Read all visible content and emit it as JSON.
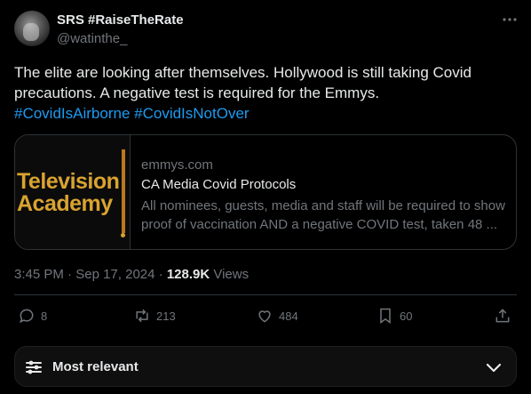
{
  "author": {
    "name": "SRS #RaiseTheRate",
    "handle": "@watinthe_"
  },
  "tweet": {
    "text": "The elite are looking after themselves. Hollywood is still taking Covid precautions. A negative test is required for the Emmys.",
    "hashtags": [
      "#CovidIsAirborne",
      "#CovidIsNotOver"
    ]
  },
  "card": {
    "logo_line1": "Television",
    "logo_line2": "Academy",
    "domain": "emmys.com",
    "title": "CA Media Covid Protocols",
    "description": "All nominees, guests, media and staff will be required to show proof of vaccination AND a negative COVID test, taken 48 ..."
  },
  "meta": {
    "time": "3:45 PM",
    "separator": "·",
    "date": "Sep 17, 2024",
    "views_count": "128.9K",
    "views_label": "Views"
  },
  "actions": {
    "replies": "8",
    "reposts": "213",
    "likes": "484",
    "bookmarks": "60"
  },
  "sort": {
    "label": "Most relevant"
  },
  "colors": {
    "background": "#000000",
    "text": "#e7e9ea",
    "muted": "#71767b",
    "link": "#1d9bf0",
    "border": "#2f3336",
    "academy_gold": "#d9a330"
  }
}
